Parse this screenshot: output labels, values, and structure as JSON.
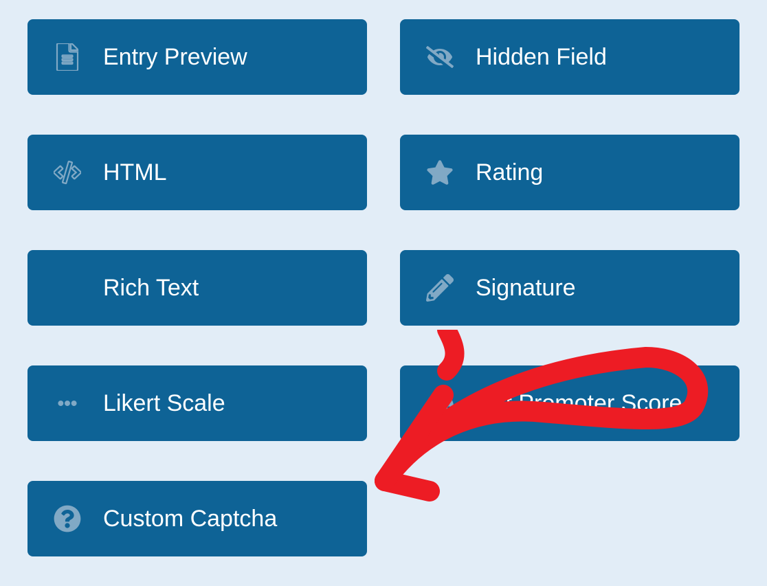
{
  "fields": [
    {
      "label": "Entry Preview",
      "icon": "file-text-icon"
    },
    {
      "label": "Hidden Field",
      "icon": "eye-slash-icon"
    },
    {
      "label": "HTML",
      "icon": "code-icon"
    },
    {
      "label": "Rating",
      "icon": "star-icon"
    },
    {
      "label": "Rich Text",
      "icon": "edit-icon"
    },
    {
      "label": "Signature",
      "icon": "pencil-icon"
    },
    {
      "label": "Likert Scale",
      "icon": "ellipsis-icon"
    },
    {
      "label": "Net Promoter Score",
      "icon": "dashboard-icon"
    },
    {
      "label": "Custom Captcha",
      "icon": "question-circle-icon"
    }
  ],
  "annotation": {
    "color": "#ed1c24"
  }
}
